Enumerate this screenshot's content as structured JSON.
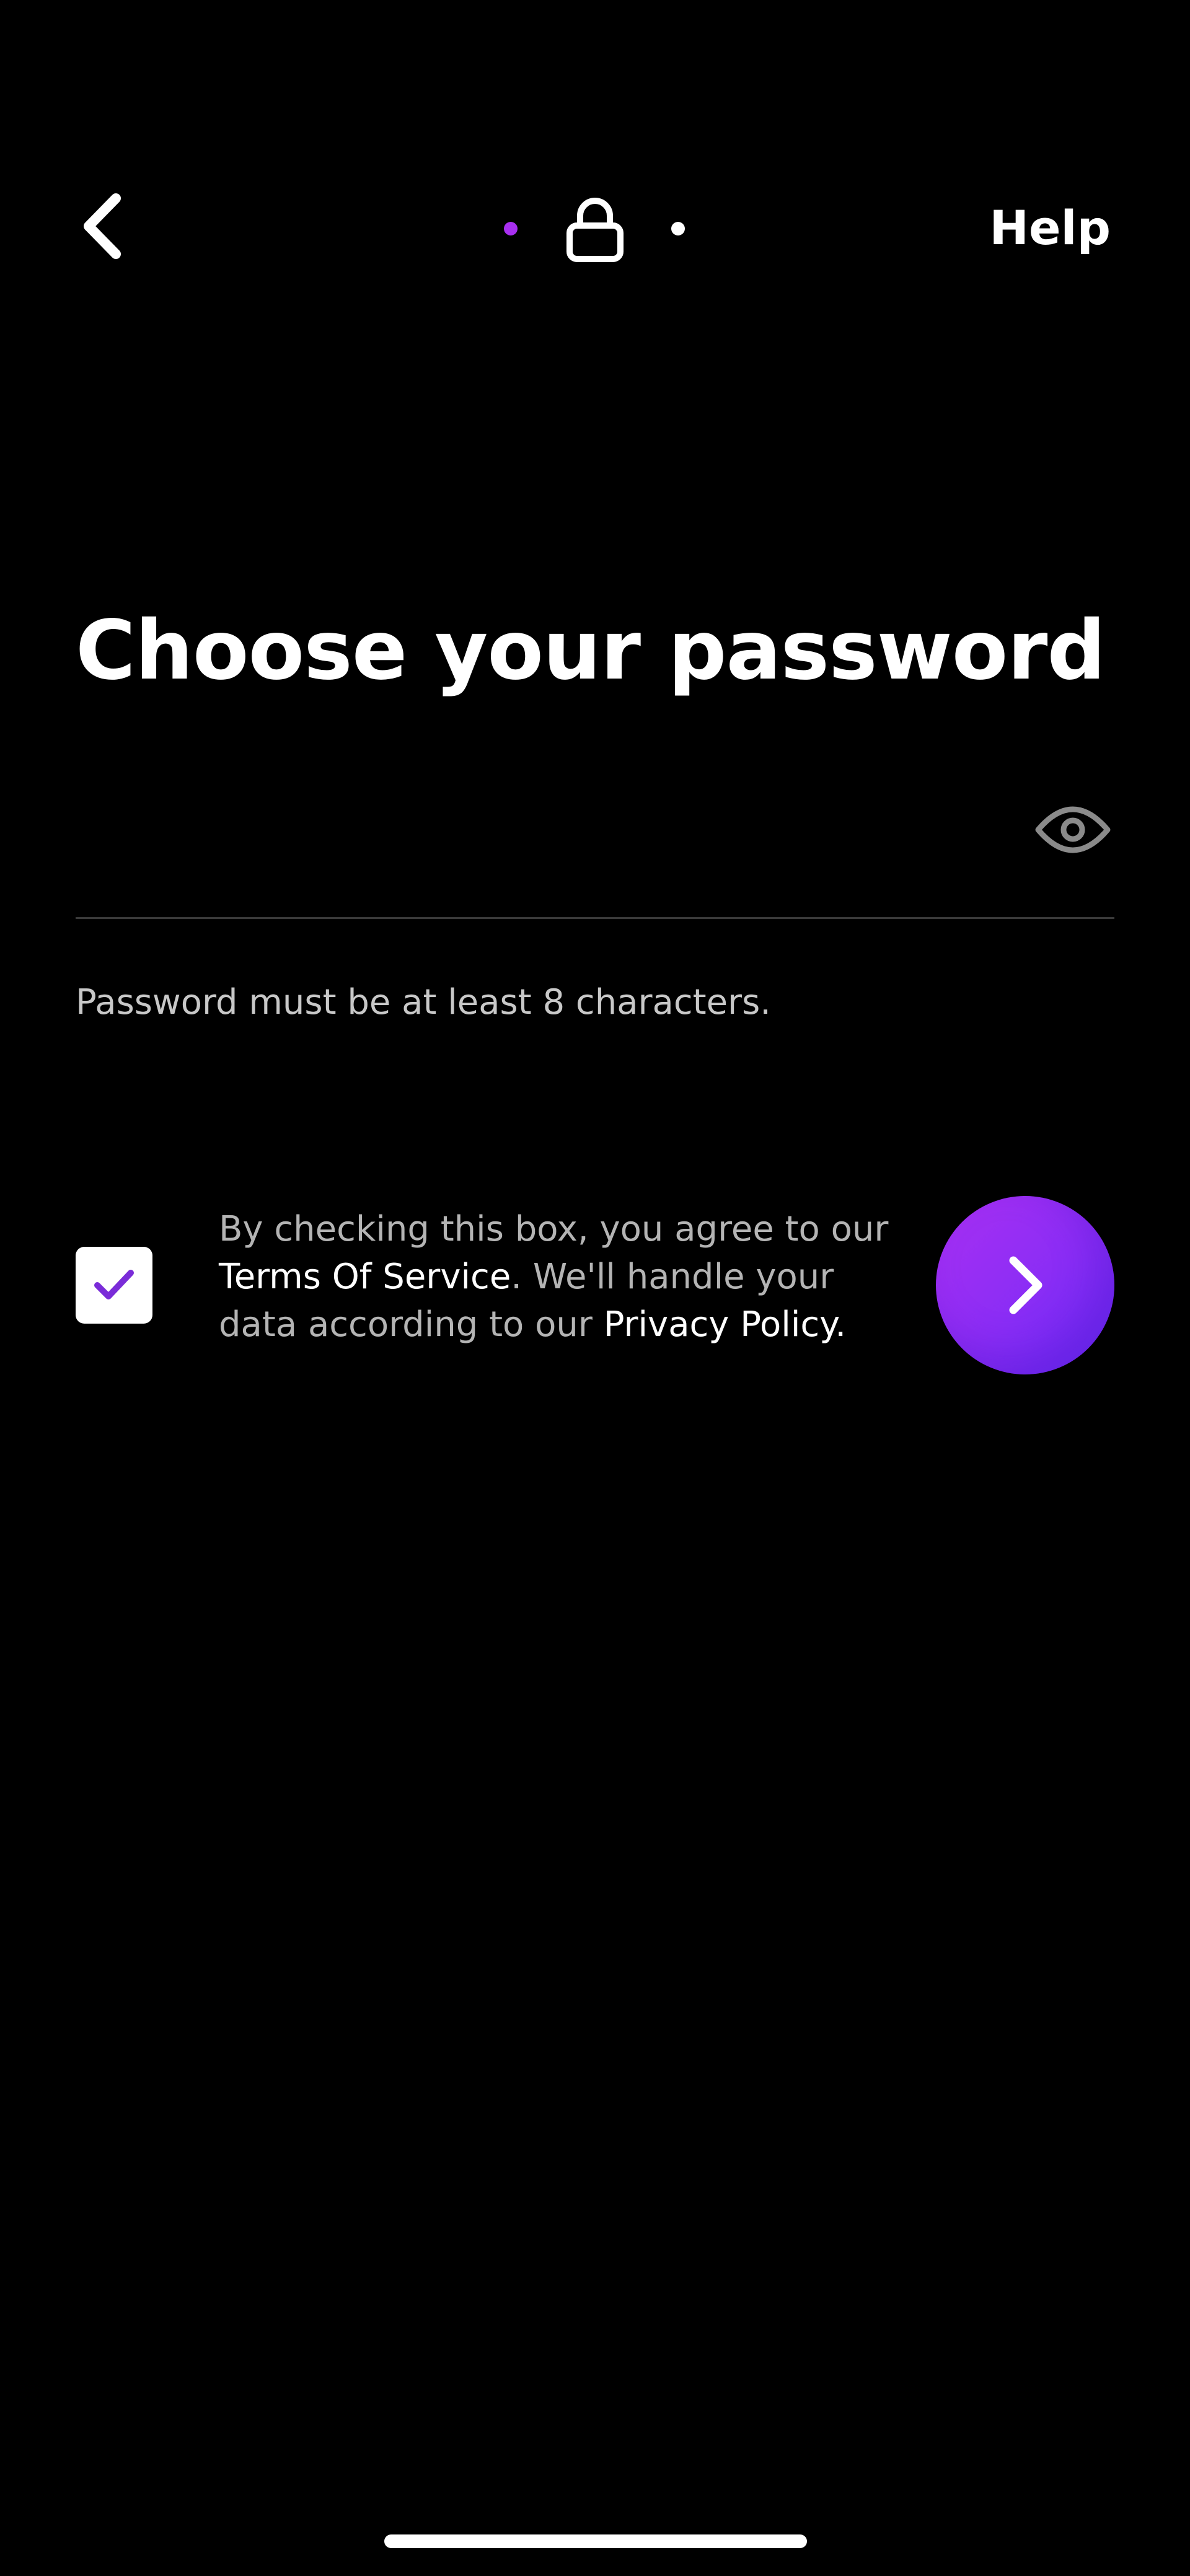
{
  "nav": {
    "help_label": "Help",
    "step_icon": "lock-icon",
    "back_icon": "chevron-left-icon"
  },
  "progress": {
    "steps": 3,
    "current_step": 2,
    "completed_color": "#a82ff0",
    "pending_color": "#ffffff"
  },
  "page": {
    "title": "Choose your password"
  },
  "password": {
    "value": "",
    "placeholder": "",
    "toggle_icon": "eye-icon",
    "hint": "Password must be at least 8 characters."
  },
  "agreement": {
    "checked": true,
    "line1": "By checking this box, you agree to our",
    "tos_link": "Terms Of Service",
    "line2_rest": ". We'll handle your",
    "line3_prefix": "data according to our ",
    "privacy_link": "Privacy Policy",
    "line3_suffix": "."
  },
  "next_button": {
    "icon": "chevron-right-icon",
    "color": "#9a2ef4"
  },
  "colors": {
    "background": "#000000",
    "accent": "#a82ff0",
    "text_primary": "#ffffff",
    "text_secondary": "#c8c8c8",
    "divider": "#3a3a3a"
  }
}
